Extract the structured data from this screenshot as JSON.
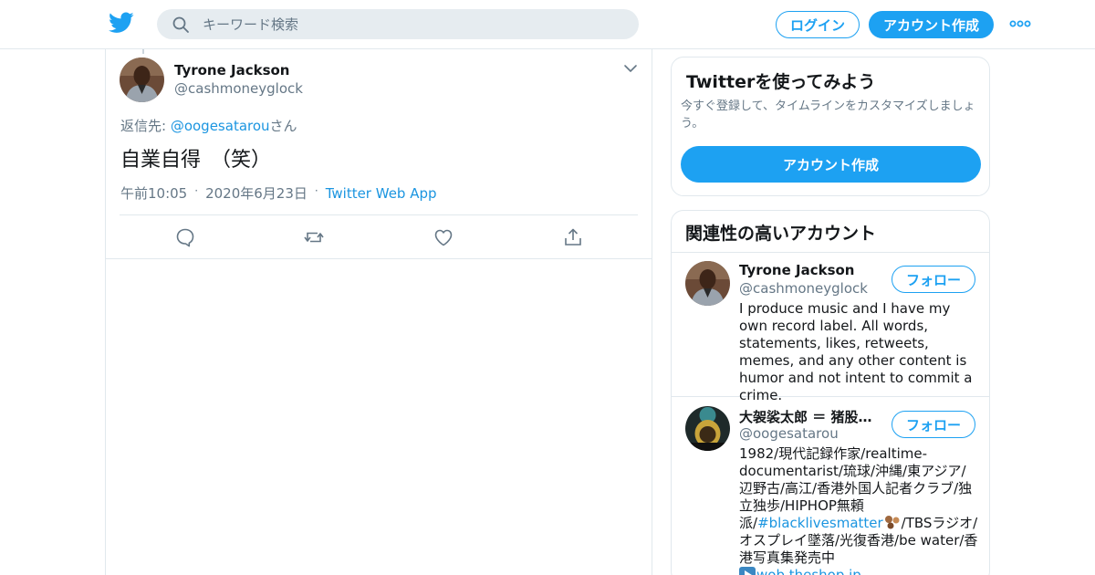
{
  "colors": {
    "brand": "#1da1f2",
    "link": "#1b95e0",
    "muted": "#657786",
    "border": "#e1e8ed"
  },
  "header": {
    "logo_icon": "twitter-bird-icon",
    "search_placeholder": "キーワード検索",
    "login_label": "ログイン",
    "signup_label": "アカウント作成",
    "more_icon": "more-dots-icon"
  },
  "tweet": {
    "author_name": "Tyrone Jackson",
    "author_handle": "@cashmoneyglock",
    "reply_prefix": "返信先: ",
    "reply_to": "@oogesatarou",
    "reply_suffix": "さん",
    "text": "自業自得　（笑）",
    "time": "午前10:05",
    "date": "2020年6月23日",
    "source": "Twitter Web App",
    "actions": [
      "reply-icon",
      "retweet-icon",
      "like-icon",
      "share-icon"
    ]
  },
  "signup_card": {
    "title": "Twitterを使ってみよう",
    "description": "今すぐ登録して、タイムラインをカスタマイズしましょう。",
    "button_label": "アカウント作成"
  },
  "related": {
    "title": "関連性の高いアカウント",
    "accounts": [
      {
        "name": "Tyrone Jackson",
        "handle": "@cashmoneyglock",
        "follow_label": "フォロー",
        "bio": "I produce music and I have my own record label. All words, statements, likes, retweets, memes, and any other content is humor and not intent to commit a crime."
      },
      {
        "name": "大袈裟太郎 ＝ 猪股東吾",
        "handle": "@oogesatarou",
        "follow_label": "フォロー",
        "bio_part1": "1982/現代記録作家/realtime-documentarist/琉球/沖縄/東アジア/辺野古/高江/香港外国人記者クラブ/独立独歩/HIPHOP無頼派/",
        "bio_hashtag": "#blacklivesmatter",
        "bio_part2": "/TBSラジオ/オスプレイ墜落/光復香港/be water/香港写真集発売中",
        "bio_link": "wob.theshop.jp"
      }
    ]
  }
}
